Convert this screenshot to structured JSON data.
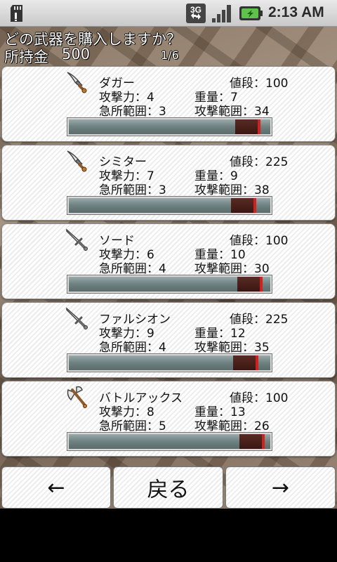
{
  "status_bar": {
    "network": "3G",
    "time": "2:13 AM"
  },
  "header": {
    "prompt": "どの武器を購入しますか？",
    "money_label": "所持金",
    "money_value": "500",
    "page_indicator": "1/6"
  },
  "weapons": [
    {
      "icon": "dagger-icon",
      "name": "ダガー",
      "price": "値段：100",
      "attack": "攻撃力：4",
      "weight": "重量：7",
      "critical_range": "急所範囲：3",
      "attack_range": "攻撃範囲：34",
      "gauge_fraction": 0.84
    },
    {
      "icon": "scimitar-icon",
      "name": "シミター",
      "price": "値段：225",
      "attack": "攻撃力：7",
      "weight": "重量：9",
      "critical_range": "急所範囲：3",
      "attack_range": "攻撃範囲：38",
      "gauge_fraction": 0.82
    },
    {
      "icon": "sword-icon",
      "name": "ソード",
      "price": "値段：100",
      "attack": "攻撃力：6",
      "weight": "重量：10",
      "critical_range": "急所範囲：4",
      "attack_range": "攻撃範囲：30",
      "gauge_fraction": 0.85
    },
    {
      "icon": "sword-icon",
      "name": "ファルシオン",
      "price": "値段：225",
      "attack": "攻撃力：9",
      "weight": "重量：12",
      "critical_range": "急所範囲：4",
      "attack_range": "攻撃範囲：35",
      "gauge_fraction": 0.83
    },
    {
      "icon": "battle-axe-icon",
      "name": "バトルアックス",
      "price": "値段：100",
      "attack": "攻撃力：8",
      "weight": "重量：13",
      "critical_range": "急所範囲：5",
      "attack_range": "攻撃範囲：26",
      "gauge_fraction": 0.86
    }
  ],
  "buttons": {
    "prev": "←",
    "back": "戻る",
    "next": "→"
  }
}
